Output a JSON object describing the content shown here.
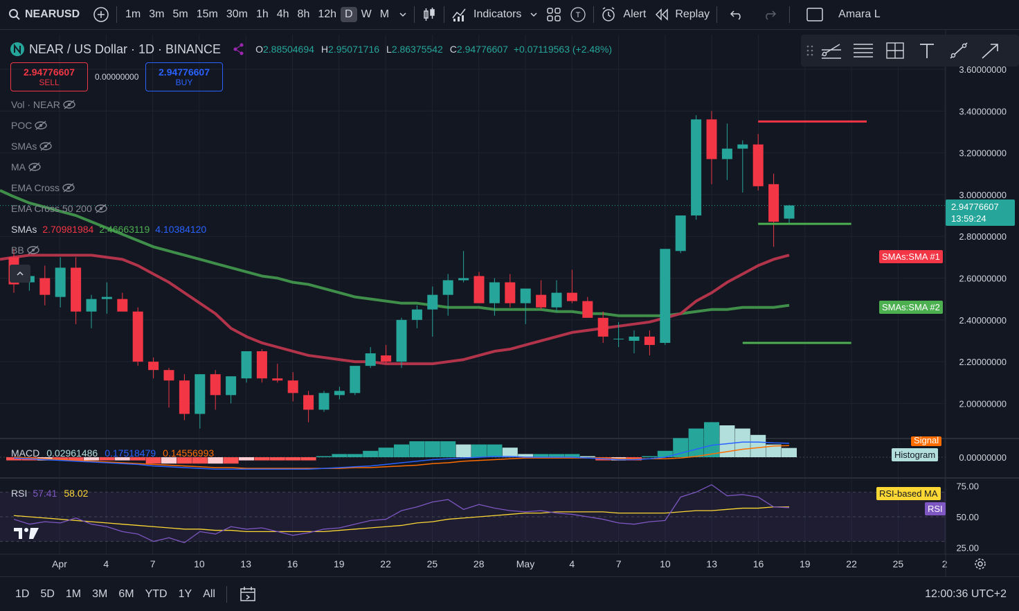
{
  "topbar": {
    "search_icon": "search-icon",
    "symbol": "NEARUSD",
    "add_symbol_icon": "plus-circle-icon",
    "timeframes": [
      "1m",
      "3m",
      "5m",
      "15m",
      "30m",
      "1h",
      "4h",
      "8h",
      "12h",
      "D",
      "W",
      "M"
    ],
    "active_timeframe": "D",
    "chart_type_icon": "candles-icon",
    "indicators_label": "Indicators",
    "templates_icon": "grid-icon",
    "alert_label": "Alert",
    "replay_label": "Replay",
    "undo_icon": "undo-icon",
    "redo_icon": "redo-icon",
    "user_name": "Amara L"
  },
  "header": {
    "title": "NEAR / US Dollar · 1D · BINANCE",
    "o_label": "O",
    "o": "2.88504694",
    "h_label": "H",
    "h": "2.95071716",
    "l_label": "L",
    "l": "2.86375542",
    "c_label": "C",
    "c": "2.94776607",
    "change": "+0.07119563 (+2.48%)",
    "sell_price": "2.94776607",
    "sell_label": "SELL",
    "spread": "0.00000000",
    "buy_price": "2.94776607",
    "buy_label": "BUY"
  },
  "legend": {
    "vol": "Vol · NEAR",
    "poc": "POC",
    "smas_a": "SMAs",
    "ma": "MA",
    "ema_cross": "EMA Cross",
    "ema_cross_2": "EMA Cross 50 200",
    "smas_label": "SMAs",
    "sma1": "2.70981984",
    "sma2": "2.46663119",
    "sma3": "4.10384120",
    "bb": "BB"
  },
  "price_axis": {
    "labels": [
      "3.60000000",
      "3.40000000",
      "3.20000000",
      "3.00000000",
      "2.80000000",
      "2.60000000",
      "2.40000000",
      "2.20000000",
      "2.00000000"
    ],
    "current_price": "2.94776607",
    "countdown": "13:59:24",
    "sma1_tag": "SMAs:SMA #1",
    "sma2_tag": "SMAs:SMA #2",
    "macd_zero": "0.00000000",
    "signal_tag": "Signal",
    "histogram_tag": "Histogram",
    "rsi_labels": [
      "75.00",
      "50.00",
      "25.00"
    ],
    "rsi_ma_tag": "RSI-based MA",
    "rsi_tag": "RSI"
  },
  "macd": {
    "label": "MACD",
    "v1": "0.02961486",
    "v2": "0.17518479",
    "v3": "0.14556993"
  },
  "rsi": {
    "label": "RSI",
    "v1": "57.41",
    "v2": "58.02"
  },
  "time_axis": [
    "Apr",
    "4",
    "7",
    "10",
    "13",
    "16",
    "19",
    "22",
    "25",
    "28",
    "May",
    "4",
    "7",
    "10",
    "13",
    "16",
    "19",
    "22",
    "25",
    "2"
  ],
  "bottombar": {
    "ranges": [
      "1D",
      "5D",
      "1M",
      "3M",
      "6M",
      "YTD",
      "1Y",
      "All"
    ],
    "compare_icon": "calendar-range-icon",
    "clock": "12:00:36 UTC+2"
  },
  "colors": {
    "up": "#26a69a",
    "down": "#f23645",
    "sma1": "#b2344a",
    "sma2": "#3f8f4a",
    "macd_line": "#2962ff",
    "signal_line": "#ff6d00",
    "rsi_line": "#7e57c2",
    "rsi_ma": "#fdd835"
  },
  "chart_data": {
    "type": "candlestick",
    "price_range": [
      1.9,
      3.65
    ],
    "candles": [
      {
        "o": 2.7,
        "h": 2.74,
        "l": 2.53,
        "c": 2.57
      },
      {
        "o": 2.58,
        "h": 2.62,
        "l": 2.54,
        "c": 2.61
      },
      {
        "o": 2.6,
        "h": 2.66,
        "l": 2.47,
        "c": 2.52
      },
      {
        "o": 2.51,
        "h": 2.7,
        "l": 2.46,
        "c": 2.65
      },
      {
        "o": 2.65,
        "h": 2.7,
        "l": 2.38,
        "c": 2.44
      },
      {
        "o": 2.44,
        "h": 2.52,
        "l": 2.36,
        "c": 2.5
      },
      {
        "o": 2.5,
        "h": 2.58,
        "l": 2.43,
        "c": 2.51
      },
      {
        "o": 2.5,
        "h": 2.53,
        "l": 2.44,
        "c": 2.44
      },
      {
        "o": 2.44,
        "h": 2.46,
        "l": 2.18,
        "c": 2.2
      },
      {
        "o": 2.2,
        "h": 2.22,
        "l": 2.12,
        "c": 2.16
      },
      {
        "o": 2.16,
        "h": 2.17,
        "l": 1.98,
        "c": 2.11
      },
      {
        "o": 2.11,
        "h": 2.14,
        "l": 1.92,
        "c": 1.95
      },
      {
        "o": 1.95,
        "h": 2.14,
        "l": 1.88,
        "c": 2.14
      },
      {
        "o": 2.14,
        "h": 2.16,
        "l": 1.97,
        "c": 2.04
      },
      {
        "o": 2.04,
        "h": 2.13,
        "l": 2.0,
        "c": 2.13
      },
      {
        "o": 2.12,
        "h": 2.22,
        "l": 2.1,
        "c": 2.25
      },
      {
        "o": 2.25,
        "h": 2.26,
        "l": 2.1,
        "c": 2.12
      },
      {
        "o": 2.12,
        "h": 2.19,
        "l": 2.1,
        "c": 2.11
      },
      {
        "o": 2.11,
        "h": 2.15,
        "l": 2.01,
        "c": 2.05
      },
      {
        "o": 2.04,
        "h": 2.06,
        "l": 1.91,
        "c": 1.97
      },
      {
        "o": 1.97,
        "h": 2.06,
        "l": 1.96,
        "c": 2.05
      },
      {
        "o": 2.04,
        "h": 2.08,
        "l": 2.02,
        "c": 2.06
      },
      {
        "o": 2.05,
        "h": 2.18,
        "l": 2.04,
        "c": 2.18
      },
      {
        "o": 2.18,
        "h": 2.27,
        "l": 2.17,
        "c": 2.24
      },
      {
        "o": 2.23,
        "h": 2.28,
        "l": 2.19,
        "c": 2.2
      },
      {
        "o": 2.2,
        "h": 2.41,
        "l": 2.17,
        "c": 2.4
      },
      {
        "o": 2.4,
        "h": 2.47,
        "l": 2.36,
        "c": 2.45
      },
      {
        "o": 2.45,
        "h": 2.56,
        "l": 2.32,
        "c": 2.52
      },
      {
        "o": 2.52,
        "h": 2.62,
        "l": 2.42,
        "c": 2.59
      },
      {
        "o": 2.59,
        "h": 2.73,
        "l": 2.58,
        "c": 2.6
      },
      {
        "o": 2.61,
        "h": 2.63,
        "l": 2.49,
        "c": 2.48
      },
      {
        "o": 2.48,
        "h": 2.6,
        "l": 2.42,
        "c": 2.58
      },
      {
        "o": 2.58,
        "h": 2.62,
        "l": 2.46,
        "c": 2.48
      },
      {
        "o": 2.48,
        "h": 2.55,
        "l": 2.38,
        "c": 2.55
      },
      {
        "o": 2.52,
        "h": 2.59,
        "l": 2.45,
        "c": 2.46
      },
      {
        "o": 2.46,
        "h": 2.59,
        "l": 2.44,
        "c": 2.53
      },
      {
        "o": 2.53,
        "h": 2.64,
        "l": 2.48,
        "c": 2.49
      },
      {
        "o": 2.49,
        "h": 2.51,
        "l": 2.41,
        "c": 2.41
      },
      {
        "o": 2.41,
        "h": 2.44,
        "l": 2.29,
        "c": 2.32
      },
      {
        "o": 2.31,
        "h": 2.39,
        "l": 2.27,
        "c": 2.31
      },
      {
        "o": 2.3,
        "h": 2.35,
        "l": 2.24,
        "c": 2.32
      },
      {
        "o": 2.32,
        "h": 2.35,
        "l": 2.23,
        "c": 2.28
      },
      {
        "o": 2.29,
        "h": 2.74,
        "l": 2.28,
        "c": 2.74
      },
      {
        "o": 2.73,
        "h": 2.9,
        "l": 2.72,
        "c": 2.9
      },
      {
        "o": 2.9,
        "h": 3.38,
        "l": 2.88,
        "c": 3.36
      },
      {
        "o": 3.36,
        "h": 3.4,
        "l": 3.05,
        "c": 3.17
      },
      {
        "o": 3.17,
        "h": 3.34,
        "l": 3.07,
        "c": 3.22
      },
      {
        "o": 3.22,
        "h": 3.26,
        "l": 3.01,
        "c": 3.24
      },
      {
        "o": 3.24,
        "h": 3.29,
        "l": 3.02,
        "c": 3.04
      },
      {
        "o": 3.05,
        "h": 3.1,
        "l": 2.75,
        "c": 2.87
      },
      {
        "o": 2.885,
        "h": 2.951,
        "l": 2.864,
        "c": 2.948
      }
    ],
    "sma1": [
      2.7,
      2.71,
      2.71,
      2.71,
      2.71,
      2.71,
      2.7,
      2.69,
      2.66,
      2.62,
      2.58,
      2.53,
      2.48,
      2.43,
      2.36,
      2.32,
      2.29,
      2.27,
      2.25,
      2.23,
      2.22,
      2.21,
      2.2,
      2.2,
      2.19,
      2.19,
      2.19,
      2.19,
      2.2,
      2.21,
      2.23,
      2.25,
      2.26,
      2.28,
      2.3,
      2.32,
      2.34,
      2.35,
      2.36,
      2.37,
      2.38,
      2.39,
      2.41,
      2.43,
      2.49,
      2.53,
      2.58,
      2.62,
      2.66,
      2.69,
      2.71
    ],
    "sma2": [
      2.99,
      2.96,
      2.94,
      2.92,
      2.9,
      2.87,
      2.84,
      2.81,
      2.78,
      2.75,
      2.73,
      2.71,
      2.69,
      2.67,
      2.65,
      2.63,
      2.61,
      2.6,
      2.58,
      2.57,
      2.55,
      2.53,
      2.51,
      2.5,
      2.49,
      2.48,
      2.48,
      2.47,
      2.46,
      2.46,
      2.46,
      2.45,
      2.45,
      2.45,
      2.45,
      2.44,
      2.44,
      2.43,
      2.43,
      2.42,
      2.42,
      2.42,
      2.42,
      2.43,
      2.44,
      2.45,
      2.45,
      2.46,
      2.46,
      2.46,
      2.47
    ],
    "hlines": [
      {
        "price": 3.35,
        "from": 48,
        "to": 55,
        "color": "#f23645"
      },
      {
        "price": 2.86,
        "from": 48,
        "to": 54,
        "color": "#4caf50"
      },
      {
        "price": 2.29,
        "from": 47,
        "to": 54,
        "color": "#4caf50"
      }
    ],
    "rsi": [
      48,
      44,
      46,
      45,
      49,
      44,
      42,
      38,
      36,
      30,
      33,
      29,
      38,
      36,
      42,
      40,
      41,
      38,
      35,
      37,
      40,
      41,
      44,
      47,
      48,
      55,
      58,
      62,
      64,
      56,
      60,
      57,
      55,
      54,
      55,
      53,
      52,
      50,
      48,
      45,
      44,
      46,
      47,
      66,
      70,
      76,
      67,
      68,
      66,
      58,
      57.41
    ],
    "rsi_ma": [
      51,
      50,
      49,
      48,
      47,
      46,
      45,
      44,
      43,
      42,
      41,
      40,
      40,
      39,
      39,
      38,
      38,
      38,
      38,
      38,
      38,
      39,
      40,
      41,
      42,
      43,
      45,
      46,
      48,
      49,
      50,
      51,
      52,
      53,
      53,
      54,
      54,
      54,
      54,
      53,
      53,
      53,
      53,
      54,
      55,
      55,
      56,
      57,
      57,
      58,
      58.02
    ],
    "macd": [
      -0.01,
      -0.02,
      -0.03,
      -0.04,
      -0.05,
      -0.06,
      -0.07,
      -0.08,
      -0.09,
      -0.11,
      -0.12,
      -0.13,
      -0.14,
      -0.15,
      -0.15,
      -0.15,
      -0.15,
      -0.15,
      -0.15,
      -0.15,
      -0.14,
      -0.13,
      -0.12,
      -0.11,
      -0.09,
      -0.07,
      -0.05,
      -0.03,
      -0.02,
      -0.01,
      0.0,
      0.01,
      0.01,
      0.0,
      0.0,
      0.0,
      0.0,
      -0.01,
      -0.02,
      -0.03,
      -0.03,
      -0.02,
      0.0,
      0.05,
      0.1,
      0.15,
      0.17,
      0.19,
      0.19,
      0.18,
      0.175
    ],
    "signal": [
      0.0,
      -0.01,
      -0.02,
      -0.03,
      -0.04,
      -0.05,
      -0.06,
      -0.07,
      -0.08,
      -0.09,
      -0.1,
      -0.11,
      -0.12,
      -0.13,
      -0.13,
      -0.14,
      -0.14,
      -0.14,
      -0.14,
      -0.14,
      -0.14,
      -0.14,
      -0.13,
      -0.13,
      -0.12,
      -0.11,
      -0.1,
      -0.08,
      -0.07,
      -0.05,
      -0.04,
      -0.03,
      -0.02,
      -0.01,
      -0.01,
      -0.01,
      -0.01,
      -0.01,
      -0.01,
      -0.02,
      -0.02,
      -0.02,
      -0.02,
      -0.01,
      0.01,
      0.04,
      0.07,
      0.1,
      0.12,
      0.14,
      0.146
    ]
  }
}
